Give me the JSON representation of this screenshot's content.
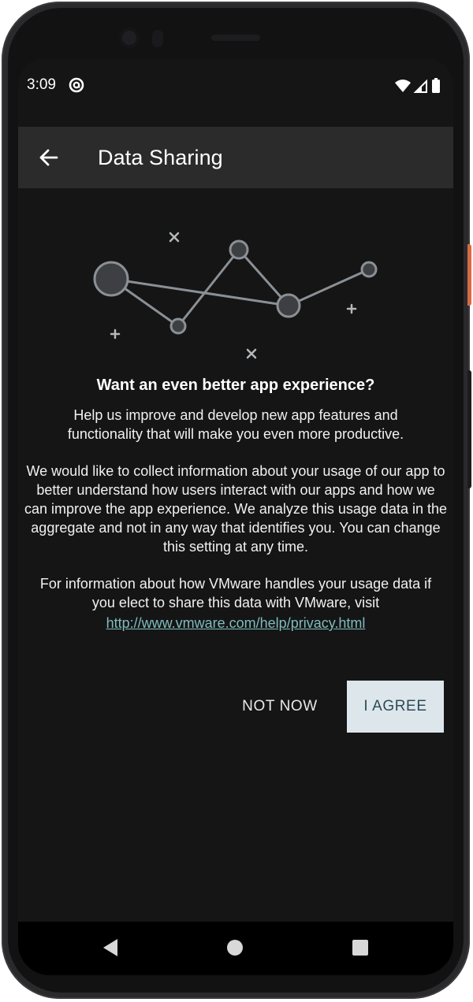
{
  "status_bar": {
    "time": "3:09",
    "notification_icon": "at-sign-icon",
    "icons": [
      "wifi-icon",
      "cell-signal-icon",
      "battery-icon"
    ]
  },
  "app_bar": {
    "back_icon": "arrow-left-icon",
    "title": "Data Sharing"
  },
  "content": {
    "heading": "Want an even better app experience?",
    "paragraph_1": "Help us improve and develop new app features and functionality that will make you even more productive.",
    "paragraph_2": "We would like to collect information about your usage of our app to better understand how users interact with our apps and how we can improve the app experience. We analyze this usage data in the aggregate and not in any way that identifies you. You can change this setting at any time.",
    "paragraph_3": "For information about how VMware handles your usage data if you elect to share this data with VMware, visit",
    "privacy_link": "http://www.vmware.com/help/privacy.html"
  },
  "actions": {
    "not_now_label": "NOT NOW",
    "agree_label": "I AGREE"
  },
  "nav_bar": {
    "icons": [
      "nav-back-icon",
      "nav-home-icon",
      "nav-recents-icon"
    ]
  },
  "colors": {
    "background": "#151515",
    "app_bar": "#2b2b2b",
    "link": "#7fbcbd",
    "agree_button_bg": "#dde6ea",
    "agree_button_text": "#2c4a5a"
  }
}
